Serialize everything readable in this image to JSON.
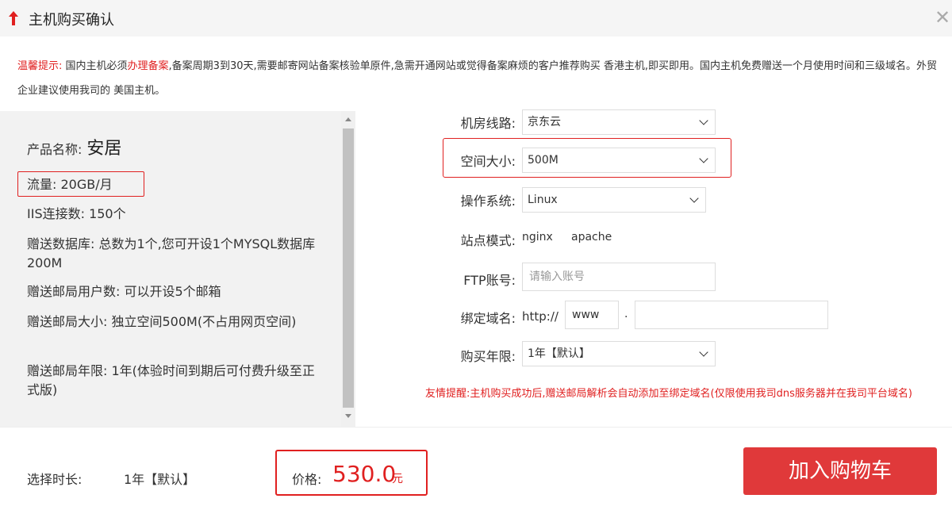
{
  "dialog": {
    "title": "主机购买确认",
    "close_glyph": "✕"
  },
  "notice": {
    "prefix": "温馨提示:",
    "part1": " 国内主机必须",
    "link": "办理备案",
    "part2": ",备案周期3到30天,需要邮寄网站备案核验单原件,急需开通网站或觉得备案麻烦的客户推荐购买 香港主机,即买即用。国内主机免费赠送一个月使用时间和三级域名。外贸企业建议使用我司的 美国主机。"
  },
  "product": {
    "name_label": "产品名称:",
    "name_value": "安居",
    "traffic": "流量: 20GB/月",
    "iis": "IIS连接数: 150个",
    "db": "赠送数据库: 总数为1个,您可开设1个MYSQL数据库200M",
    "mail_users": "赠送邮局用户数: 可以开设5个邮箱",
    "mail_size": "赠送邮局大小: 独立空间500M(不占用网页空间)",
    "mail_years": "赠送邮局年限: 1年(体验时间到期后可付费升级至正式版)"
  },
  "form": {
    "line_label": "机房线路:",
    "line_value": "京东云",
    "space_label": "空间大小:",
    "space_value": "500M",
    "os_label": "操作系统:",
    "os_value": "Linux",
    "mode_label": "站点模式:",
    "mode_opt1": "nginx",
    "mode_opt2": "apache",
    "ftp_label": "FTP账号:",
    "ftp_placeholder": "请输入账号",
    "domain_label": "绑定域名:",
    "domain_prefix": "http://",
    "domain_www": "www",
    "domain_dot": ".",
    "year_label": "购买年限:",
    "year_value": "1年【默认】"
  },
  "tip": "友情提醒:主机购买成功后,赠送邮局解析会自动添加至绑定域名(仅限使用我司dns服务器并在我司平台域名)",
  "footer": {
    "duration_label": "选择时长:",
    "duration_value": "1年【默认】",
    "price_label": "价格:",
    "price_value": "530.0",
    "price_unit": "元",
    "cart_button": "加入购物车"
  }
}
